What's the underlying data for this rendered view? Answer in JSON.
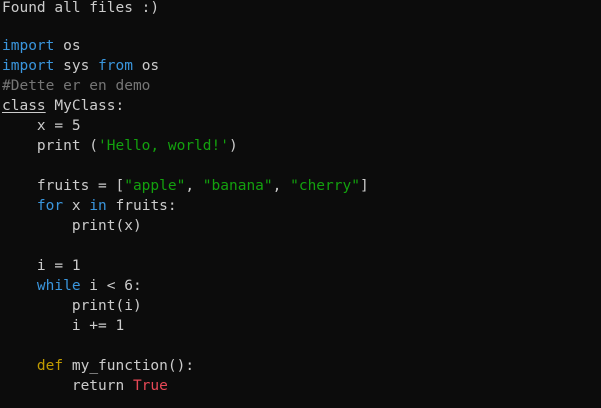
{
  "terminal": {
    "output_line": "Found all files :)",
    "code_lines": [
      [],
      [
        {
          "t": "import",
          "c": "kw"
        },
        {
          "t": " os",
          "c": "plain"
        }
      ],
      [
        {
          "t": "import",
          "c": "kw"
        },
        {
          "t": " sys ",
          "c": "plain"
        },
        {
          "t": "from",
          "c": "kw"
        },
        {
          "t": " os",
          "c": "plain"
        }
      ],
      [
        {
          "t": "#Dette er en demo",
          "c": "cmt"
        }
      ],
      [
        {
          "t": "class",
          "c": "plain underline"
        },
        {
          "t": " MyClass:",
          "c": "plain"
        }
      ],
      [
        {
          "t": "    x = 5",
          "c": "plain"
        }
      ],
      [
        {
          "t": "    print (",
          "c": "plain"
        },
        {
          "t": "'Hello, world!'",
          "c": "str"
        },
        {
          "t": ")",
          "c": "plain"
        }
      ],
      [],
      [
        {
          "t": "    fruits = [",
          "c": "plain"
        },
        {
          "t": "\"apple\"",
          "c": "str"
        },
        {
          "t": ", ",
          "c": "plain"
        },
        {
          "t": "\"banana\"",
          "c": "str"
        },
        {
          "t": ", ",
          "c": "plain"
        },
        {
          "t": "\"cherry\"",
          "c": "str"
        },
        {
          "t": "]",
          "c": "plain"
        }
      ],
      [
        {
          "t": "    ",
          "c": "plain"
        },
        {
          "t": "for",
          "c": "kw"
        },
        {
          "t": " x ",
          "c": "plain"
        },
        {
          "t": "in",
          "c": "kw"
        },
        {
          "t": " fruits:",
          "c": "plain"
        }
      ],
      [
        {
          "t": "        print(x)",
          "c": "plain"
        }
      ],
      [],
      [
        {
          "t": "    i = 1",
          "c": "plain"
        }
      ],
      [
        {
          "t": "    ",
          "c": "plain"
        },
        {
          "t": "while",
          "c": "kw"
        },
        {
          "t": " i < 6:",
          "c": "plain"
        }
      ],
      [
        {
          "t": "        print(i)",
          "c": "plain"
        }
      ],
      [
        {
          "t": "        i += 1",
          "c": "plain"
        }
      ],
      [],
      [
        {
          "t": "    ",
          "c": "plain"
        },
        {
          "t": "def",
          "c": "kw-def"
        },
        {
          "t": " my_function():",
          "c": "plain"
        }
      ],
      [
        {
          "t": "        return ",
          "c": "plain"
        },
        {
          "t": "True",
          "c": "const"
        }
      ]
    ]
  },
  "colors": {
    "background": "#0c0c0c",
    "text": "#cccccc",
    "keyword": "#3a96dd",
    "def_keyword": "#c19c00",
    "string": "#13a10e",
    "constant": "#e74856",
    "comment": "#767676"
  }
}
